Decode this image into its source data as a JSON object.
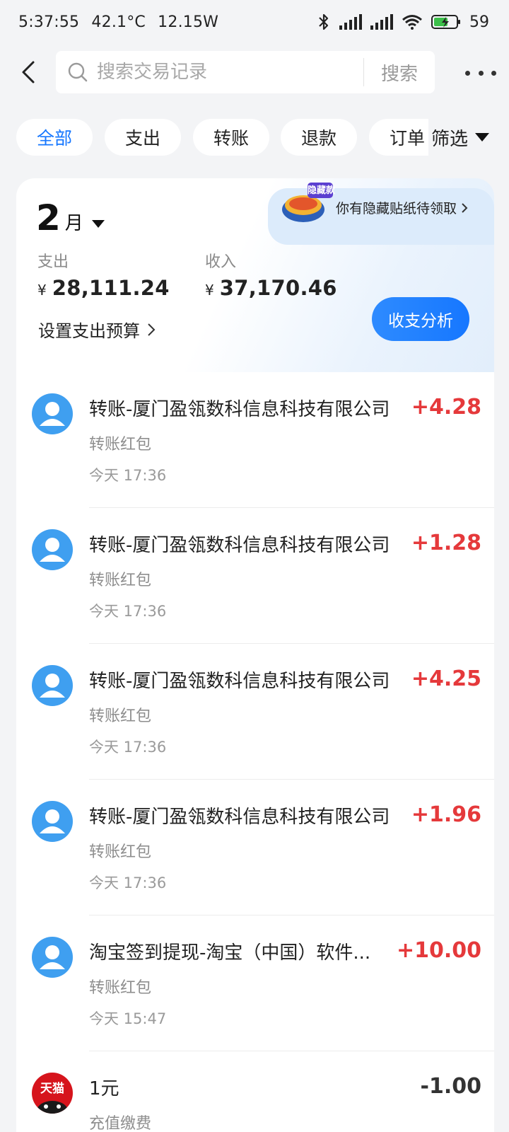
{
  "status_bar": {
    "time": "5:37:55",
    "temperature": "42.1°C",
    "power": "12.15W",
    "battery": "59",
    "icons": [
      "bluetooth-icon",
      "signal-icon",
      "signal-icon",
      "wifi-icon",
      "battery-charging-icon"
    ]
  },
  "header": {
    "search_placeholder": "搜索交易记录",
    "search_button": "搜索"
  },
  "filters": {
    "chips": [
      "全部",
      "支出",
      "转账",
      "退款",
      "订单"
    ],
    "active_index": 0,
    "filter_label": "筛选"
  },
  "summary": {
    "month_number": "2",
    "month_unit": "月",
    "sticker_text": "你有隐藏贴纸待领取",
    "sticker_badge": "隐藏款",
    "expense_label": "支出",
    "expense_currency": "¥",
    "expense_value": "28,111.24",
    "income_label": "收入",
    "income_currency": "¥",
    "income_value": "37,170.46",
    "budget_label": "设置支出预算",
    "analysis_button": "收支分析"
  },
  "transactions": [
    {
      "title": "转账-厦门盈瓴数科信息科技有限公司",
      "subtitle": "转账红包",
      "time": "今天 17:36",
      "amount": "+4.28",
      "type": "income"
    },
    {
      "title": "转账-厦门盈瓴数科信息科技有限公司",
      "subtitle": "转账红包",
      "time": "今天 17:36",
      "amount": "+1.28",
      "type": "income"
    },
    {
      "title": "转账-厦门盈瓴数科信息科技有限公司",
      "subtitle": "转账红包",
      "time": "今天 17:36",
      "amount": "+4.25",
      "type": "income"
    },
    {
      "title": "转账-厦门盈瓴数科信息科技有限公司",
      "subtitle": "转账红包",
      "time": "今天 17:36",
      "amount": "+1.96",
      "type": "income"
    },
    {
      "title": "淘宝签到提现-淘宝（中国）软件...",
      "subtitle": "转账红包",
      "time": "今天 15:47",
      "amount": "+10.00",
      "type": "income"
    },
    {
      "title": "1元",
      "subtitle": "充值缴费",
      "time": "",
      "amount": "-1.00",
      "type": "expense",
      "avatar_text": "天猫"
    }
  ],
  "colors": {
    "accent": "#1677ff",
    "income": "#e5393b",
    "avatar_blue": "#3f9ff0",
    "tmall_red": "#d6141c",
    "background": "#f3f4f6"
  }
}
